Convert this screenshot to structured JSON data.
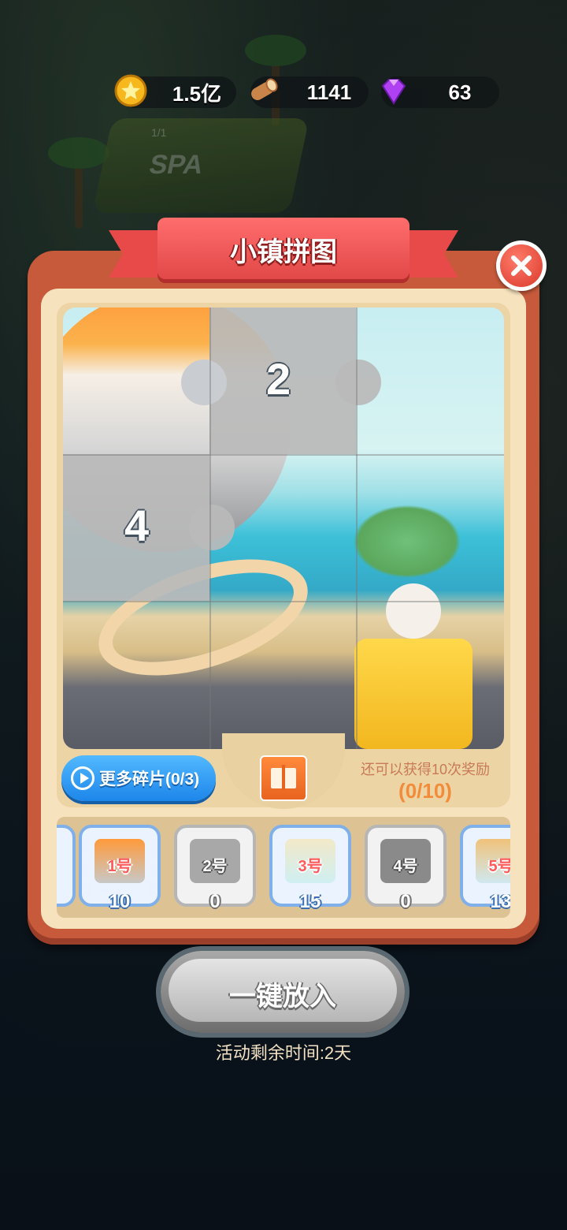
{
  "resources": [
    {
      "icon": "gold-coin-icon",
      "value": "1.5亿"
    },
    {
      "icon": "wood-log-icon",
      "value": "1141"
    },
    {
      "icon": "purple-gem-icon",
      "value": "63"
    }
  ],
  "background": {
    "spa_sign": "SPA",
    "occupancy": "1/1"
  },
  "dialog": {
    "title": "小镇拼图",
    "close_icon": "close-icon",
    "puzzle_piece_numbers": [
      "2",
      "4"
    ],
    "more_pieces_label": "更多碎片(0/3)",
    "reward_text": "还可以获得10次奖励",
    "reward_progress": "(0/10)",
    "pieces": [
      {
        "label": "1号",
        "count": "10",
        "style": "blue"
      },
      {
        "label": "2号",
        "count": "0",
        "style": "grey"
      },
      {
        "label": "3号",
        "count": "15",
        "style": "blue"
      },
      {
        "label": "4号",
        "count": "0",
        "style": "grey"
      },
      {
        "label": "5号",
        "count": "13",
        "style": "blue"
      }
    ],
    "place_all_label": "一键放入",
    "time_left": "活动剩余时间:2天"
  }
}
